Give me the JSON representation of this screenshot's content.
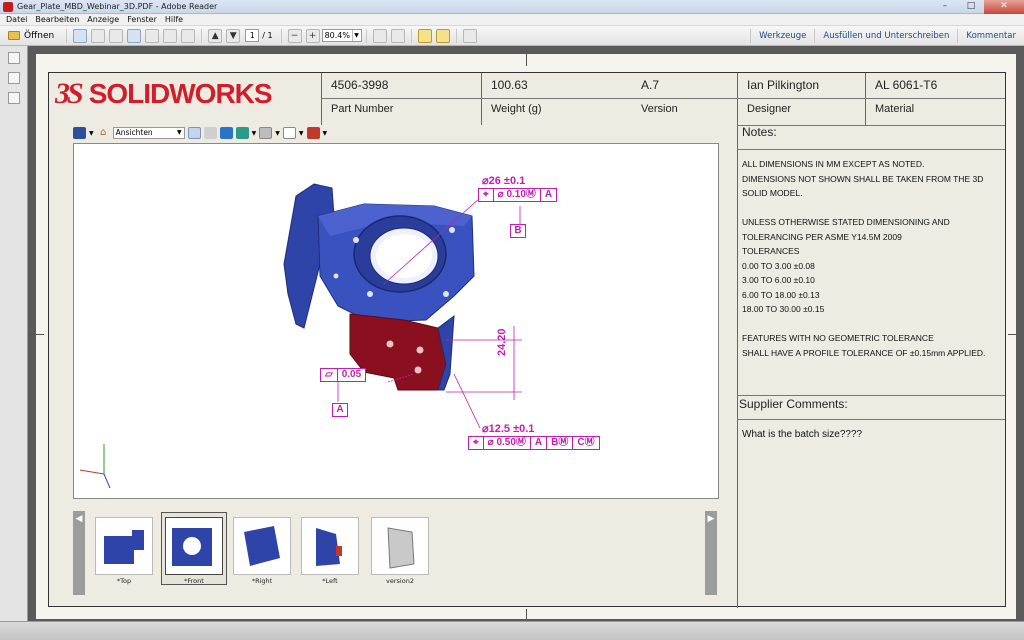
{
  "window": {
    "title": "Gear_Plate_MBD_Webinar_3D.PDF - Adobe Reader",
    "controls": {
      "minimize": "–",
      "maximize": "□",
      "close": "✕"
    }
  },
  "menu": [
    "Datei",
    "Bearbeiten",
    "Anzeige",
    "Fenster",
    "Hilfe"
  ],
  "toolbar": {
    "open_label": "Öffnen",
    "page_current": "1",
    "page_total": "/ 1",
    "zoom": "80.4%",
    "right": [
      "Werkzeuge",
      "Ausfüllen und Unterschreiben",
      "Kommentar"
    ]
  },
  "titleblock": {
    "part_number": "4506-3998",
    "part_number_label": "Part Number",
    "weight": "100.63",
    "weight_label": "Weight (g)",
    "version": "A.7",
    "version_label": "Version",
    "designer": "Ian Pilkington",
    "designer_label": "Designer",
    "material": "AL 6061-T6",
    "material_label": "Material"
  },
  "logo": {
    "mark": "3S",
    "solid": "SOLID",
    "works": "WORKS"
  },
  "viewer3d": {
    "view_select": "Ansichten",
    "annotations": {
      "dia1": "⌀26 ±0.1",
      "fcf1": [
        "⌖",
        "⌀ 0.10Ⓜ",
        "A"
      ],
      "datum_b": "B",
      "flatness": [
        "▱",
        "0.05"
      ],
      "datum_a": "A",
      "dim_height": "24.20",
      "dia2": "⌀12.5 ±0.1",
      "fcf2": [
        "⌖",
        "⌀ 0.50Ⓜ",
        "A",
        "BⓂ",
        "CⓂ"
      ]
    }
  },
  "thumbnails": [
    {
      "label": "*Top"
    },
    {
      "label": "*Front"
    },
    {
      "label": "*Right"
    },
    {
      "label": "*Left"
    },
    {
      "label": "version2"
    }
  ],
  "notes": {
    "title": "Notes:",
    "lines": [
      "ALL DIMENSIONS IN MM EXCEPT AS NOTED.",
      "DIMENSIONS NOT SHOWN SHALL BE TAKEN FROM THE 3D",
      "SOLID MODEL.",
      "",
      "UNLESS OTHERWISE STATED DIMENSIONING AND",
      "TOLERANCING PER ASME Y14.5M 2009",
      "TOLERANCES",
      "0.00 TO 3.00 ±0.08",
      "3.00 TO 6.00 ±0.10",
      "6.00 TO 18.00 ±0.13",
      "18.00 TO 30.00 ±0.15",
      "",
      "FEATURES WITH NO GEOMETRIC TOLERANCE",
      "SHALL HAVE A PROFILE TOLERANCE OF ±0.15mm APPLIED."
    ]
  },
  "supplier": {
    "title": "Supplier Comments:",
    "comment": "What is the batch size????"
  },
  "colors": {
    "part_blue": "#2b3fa8",
    "part_red": "#8a1020",
    "annotation": "#c21fb0",
    "brand_red": "#d01e2a"
  }
}
